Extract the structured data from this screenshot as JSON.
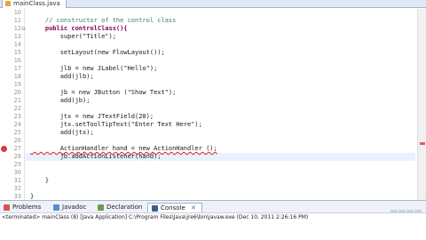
{
  "editor_tab": {
    "label": "mainClass.java"
  },
  "gutter": {
    "line_numbers": [
      "10",
      "11",
      "12",
      "13",
      "14",
      "15",
      "16",
      "17",
      "18",
      "19",
      "20",
      "21",
      "22",
      "23",
      "24",
      "25",
      "26",
      "27",
      "28",
      "29",
      "30",
      "31",
      "32",
      "33"
    ]
  },
  "code": {
    "lines": [
      "",
      "    // constructor of the control class",
      "    public controlClass(){",
      "        super(\"Title\");",
      "",
      "        setLayout(new FlowLayout());",
      "",
      "        jlb = new JLabel(\"Hello\");",
      "        add(jlb);",
      "",
      "        jb = new JButton (\"Show Text\");",
      "        add(jb);",
      "",
      "        jtx = new JTextField(20);",
      "        jtx.setToolTipText(\"Enter Text Here\");",
      "        add(jtx);",
      "",
      "        ActionHandler hand = new ActionHandler ();",
      "        jb.addActionListener(hand);",
      "",
      "",
      "    }",
      "",
      "}"
    ]
  },
  "bottom_tabs": [
    {
      "label": "Problems",
      "icon": "problems-icon",
      "color": "#d9534f"
    },
    {
      "label": "Javadoc",
      "icon": "javadoc-icon",
      "color": "#5b8ccf"
    },
    {
      "label": "Declaration",
      "icon": "declaration-icon",
      "color": "#6a9f4a"
    },
    {
      "label": "Console",
      "icon": "console-icon",
      "color": "#3a5f8f",
      "active": true,
      "close": "✕"
    }
  ],
  "console": {
    "status": "<terminated> mainClass (8) [Java Application] C:\\Program Files\\Java\\jre6\\bin\\javaw.exe (Dec 10, 2011 2:26:16 PM)"
  }
}
